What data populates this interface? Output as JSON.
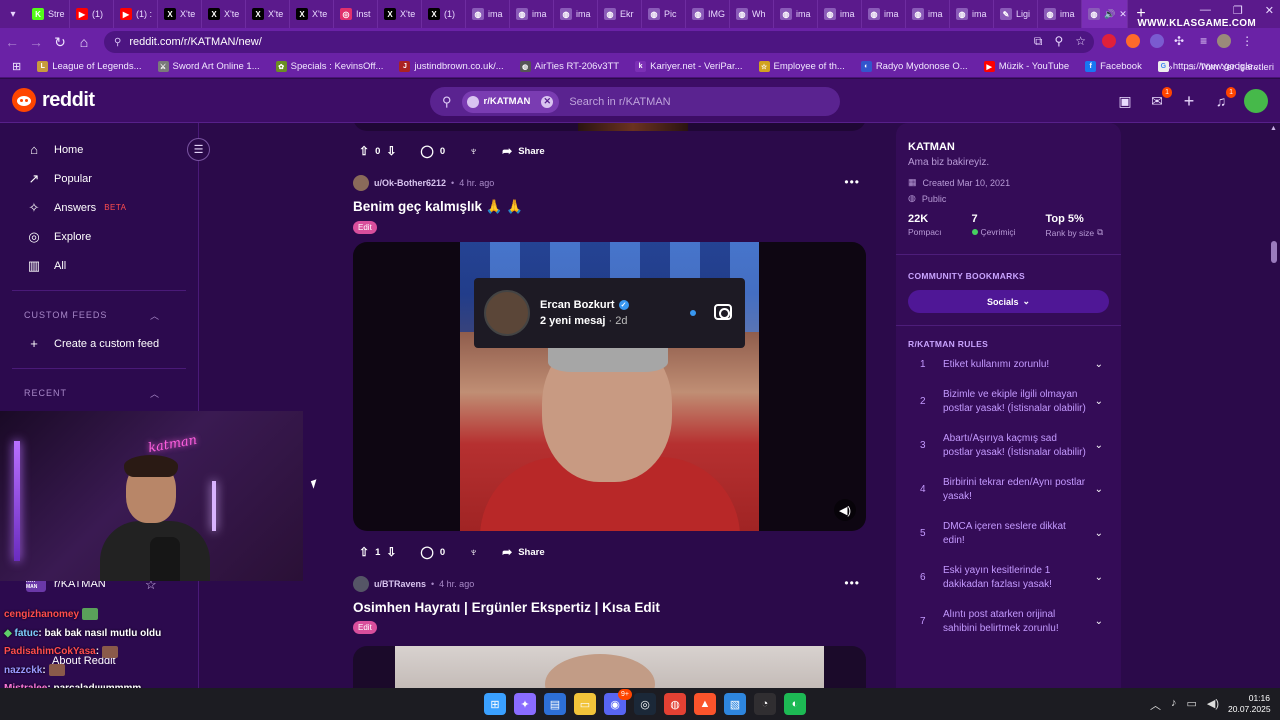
{
  "browser": {
    "tabs": [
      {
        "label": "Stre",
        "favicon_color": "#53fc18",
        "favicon_icon": "kick-icon",
        "glyph": "K"
      },
      {
        "label": "(1) ",
        "favicon_color": "#ff0000",
        "favicon_icon": "youtube-icon",
        "glyph": "▶"
      },
      {
        "label": "(1) :",
        "favicon_color": "#ff0000",
        "favicon_icon": "youtube-icon",
        "glyph": "▶"
      },
      {
        "label": "X'te",
        "favicon_color": "#000000",
        "favicon_icon": "x-icon",
        "glyph": "X"
      },
      {
        "label": "X'te",
        "favicon_color": "#000000",
        "favicon_icon": "x-icon",
        "glyph": "X"
      },
      {
        "label": "X'te",
        "favicon_color": "#000000",
        "favicon_icon": "x-icon",
        "glyph": "X"
      },
      {
        "label": "X'te",
        "favicon_color": "#000000",
        "favicon_icon": "x-icon",
        "glyph": "X"
      },
      {
        "label": "Inst",
        "favicon_color": "#e1306c",
        "favicon_icon": "instagram-icon",
        "glyph": "◎"
      },
      {
        "label": "X'te",
        "favicon_color": "#000000",
        "favicon_icon": "x-icon",
        "glyph": "X"
      },
      {
        "label": "(1) ",
        "favicon_color": "#000000",
        "favicon_icon": "x-icon",
        "glyph": "X"
      },
      {
        "label": "ima",
        "favicon_color": "#8a5bb8",
        "favicon_icon": "globe-icon",
        "glyph": "◍"
      },
      {
        "label": "ima",
        "favicon_color": "#8a5bb8",
        "favicon_icon": "globe-icon",
        "glyph": "◍"
      },
      {
        "label": "ima",
        "favicon_color": "#8a5bb8",
        "favicon_icon": "globe-icon",
        "glyph": "◍"
      },
      {
        "label": "Ekr",
        "favicon_color": "#8a5bb8",
        "favicon_icon": "globe-icon",
        "glyph": "◍"
      },
      {
        "label": "Pic",
        "favicon_color": "#8a5bb8",
        "favicon_icon": "globe-icon",
        "glyph": "◍"
      },
      {
        "label": "IMG",
        "favicon_color": "#8a5bb8",
        "favicon_icon": "globe-icon",
        "glyph": "◍"
      },
      {
        "label": "Wh",
        "favicon_color": "#8a5bb8",
        "favicon_icon": "globe-icon",
        "glyph": "◍"
      },
      {
        "label": "ima",
        "favicon_color": "#8a5bb8",
        "favicon_icon": "globe-icon",
        "glyph": "◍"
      },
      {
        "label": "ima",
        "favicon_color": "#8a5bb8",
        "favicon_icon": "globe-icon",
        "glyph": "◍"
      },
      {
        "label": "ima",
        "favicon_color": "#8a5bb8",
        "favicon_icon": "globe-icon",
        "glyph": "◍"
      },
      {
        "label": "ima",
        "favicon_color": "#8a5bb8",
        "favicon_icon": "globe-icon",
        "glyph": "◍"
      },
      {
        "label": "ima",
        "favicon_color": "#8a5bb8",
        "favicon_icon": "globe-icon",
        "glyph": "◍"
      },
      {
        "label": "Ligi",
        "favicon_color": "#8a5bb8",
        "favicon_icon": "pen-icon",
        "glyph": "✎"
      },
      {
        "label": "ima",
        "favicon_color": "#8a5bb8",
        "favicon_icon": "globe-icon",
        "glyph": "◍"
      }
    ],
    "active_tab_icon": "speaker-icon",
    "active_tab_glyph": "🔊",
    "watermark": "WWW.KLASGAME.COM",
    "url": "reddit.com/r/KATMAN/new/",
    "bookmarks": [
      {
        "label": "League of Legends...",
        "color": "#c89b3c",
        "icon": "lol-icon",
        "glyph": "L"
      },
      {
        "label": "Sword Art Online 1...",
        "color": "#7a7a7a",
        "icon": "sword-icon",
        "glyph": "⚔"
      },
      {
        "label": "Specials : KevinsOff...",
        "color": "#6b8e23",
        "icon": "leaf-icon",
        "glyph": "✿"
      },
      {
        "label": "justindbrown.co.uk/...",
        "color": "#aa2222",
        "icon": "globe-icon",
        "glyph": "J"
      },
      {
        "label": "AirTies RT-206v3TT",
        "color": "#555555",
        "icon": "router-icon",
        "glyph": "◍"
      },
      {
        "label": "Kariyer.net - VeriPar...",
        "color": "#7b2fb5",
        "icon": "kariyer-icon",
        "glyph": "k"
      },
      {
        "label": "Employee of th...",
        "color": "#d1a21f",
        "icon": "award-icon",
        "glyph": "☆"
      },
      {
        "label": "Radyo Mydonose O...",
        "color": "#3355cc",
        "icon": "radio-icon",
        "glyph": "◐"
      },
      {
        "label": "Müzik - YouTube",
        "color": "#ff0000",
        "icon": "youtube-icon",
        "glyph": "▶"
      },
      {
        "label": "Facebook",
        "color": "#1877f2",
        "icon": "facebook-icon",
        "glyph": "f"
      },
      {
        "label": "https://www.google...",
        "color": "#eeeeee",
        "icon": "google-icon",
        "glyph": "G"
      }
    ],
    "bookmarks_more": "»",
    "all_bookmarks": "Tüm Yer İşaretleri"
  },
  "reddit": {
    "logo": "reddit",
    "search": {
      "chip": "r/KATMAN",
      "placeholder": "Search in r/KATMAN"
    },
    "header_badges": {
      "chat": "1",
      "notifications": "1"
    },
    "nav": [
      {
        "label": "Home",
        "icon": "home-icon",
        "glyph": "⌂"
      },
      {
        "label": "Popular",
        "icon": "popular-icon",
        "glyph": "↗"
      },
      {
        "label": "Answers",
        "icon": "answers-icon",
        "glyph": "✧",
        "badge": "BETA"
      },
      {
        "label": "Explore",
        "icon": "explore-icon",
        "glyph": "◎"
      },
      {
        "label": "All",
        "icon": "all-icon",
        "glyph": "▥"
      }
    ],
    "custom_feeds_title": "CUSTOM FEEDS",
    "create_feed": "Create a custom feed",
    "recent_title": "RECENT",
    "recent_sub": "r/KATMAN",
    "recent_sub_icon_text": "KAT MAN",
    "about": "About Reddit",
    "prev_post_actions": {
      "votes": "0",
      "comments": "0",
      "share": "Share"
    },
    "posts": [
      {
        "user": "u/Ok-Bother6212",
        "time": "4 hr. ago",
        "title": "Benim geç kalmışlık 🙏 🙏",
        "flair": "Edit",
        "votes": "1",
        "comments": "0",
        "share": "Share",
        "notification": {
          "name": "Ercan Bozkurt",
          "text": "2 yeni mesaj",
          "time": "2d"
        }
      },
      {
        "user": "u/BTRavens",
        "time": "4 hr. ago",
        "title": "Osimhen Hayratı | Ergünler Ekspertiz | Kısa Edit",
        "flair": "Edit"
      }
    ],
    "community": {
      "name": "KATMAN",
      "description": "Ama biz bakireyiz.",
      "created": "Created Mar 10, 2021",
      "visibility": "Public",
      "members_value": "22K",
      "members_label": "Pompacı",
      "online_value": "7",
      "online_label": "Çevrimiçi",
      "rank_value": "Top 5%",
      "rank_label": "Rank by size",
      "bookmarks_title": "COMMUNITY BOOKMARKS",
      "socials": "Socials",
      "rules_title": "R/KATMAN RULES",
      "rules": [
        {
          "n": "1",
          "text": "Etiket kullanımı zorunlu!"
        },
        {
          "n": "2",
          "text": "Bizimle ve ekiple ilgili olmayan postlar yasak! (İstisnalar olabilir)"
        },
        {
          "n": "3",
          "text": "Abartı/Aşırıya kaçmış sad postlar yasak! (İstisnalar olabilir)"
        },
        {
          "n": "4",
          "text": "Birbirini tekrar eden/Aynı postlar yasak!"
        },
        {
          "n": "5",
          "text": "DMCA içeren seslere dikkat edin!"
        },
        {
          "n": "6",
          "text": "Eski yayın kesitlerinde 1 dakikadan fazlası yasak!"
        },
        {
          "n": "7",
          "text": "Alıntı post atarken orijinal sahibini belirtmek zorunlu!"
        }
      ]
    }
  },
  "stream": {
    "neon_sign": "katman",
    "chat": [
      {
        "user": "cengizhanomey",
        "color": "#ff4d4d",
        "msg": "",
        "emote": "#5aa05a"
      },
      {
        "user": "fatuc",
        "color": "#7fd0ff",
        "msg": ": bak bak nasıl mutlu oldu",
        "prefix": "◆"
      },
      {
        "user": "PadisahimCokYasa",
        "color": "#ff4d4d",
        "msg": ":",
        "emote": "#8a5a4a"
      },
      {
        "user": "nazzckk",
        "color": "#9a9aff",
        "msg": ":",
        "emote": "#8a5a4a"
      },
      {
        "user": "Mistralee",
        "color": "#ff7ad9",
        "msg": ": parçaladıııımmmm"
      }
    ]
  },
  "taskbar": {
    "apps": [
      {
        "name": "windows-start-icon",
        "color": "#3aa0ff",
        "glyph": "⊞"
      },
      {
        "name": "copilot-icon",
        "color": "#8a6cff",
        "glyph": "✦"
      },
      {
        "name": "store-icon",
        "color": "#2d6fd6",
        "glyph": "▤"
      },
      {
        "name": "explorer-icon",
        "color": "#f2c43a",
        "glyph": "▭"
      },
      {
        "name": "discord-icon",
        "color": "#5865f2",
        "glyph": "◉"
      },
      {
        "name": "steam-icon",
        "color": "#1b2838",
        "glyph": "◎"
      },
      {
        "name": "chrome-icon",
        "color": "#e34133",
        "glyph": "◍"
      },
      {
        "name": "brave-icon",
        "color": "#fb542b",
        "glyph": "▲"
      },
      {
        "name": "photos-icon",
        "color": "#2e86de",
        "glyph": "▧"
      },
      {
        "name": "obs-icon",
        "color": "#302e31",
        "glyph": "◔"
      },
      {
        "name": "spotify-icon",
        "color": "#1db954",
        "glyph": "◐"
      }
    ],
    "discord_badge": "9+",
    "time": "01:16",
    "date": "20.07.2025"
  }
}
